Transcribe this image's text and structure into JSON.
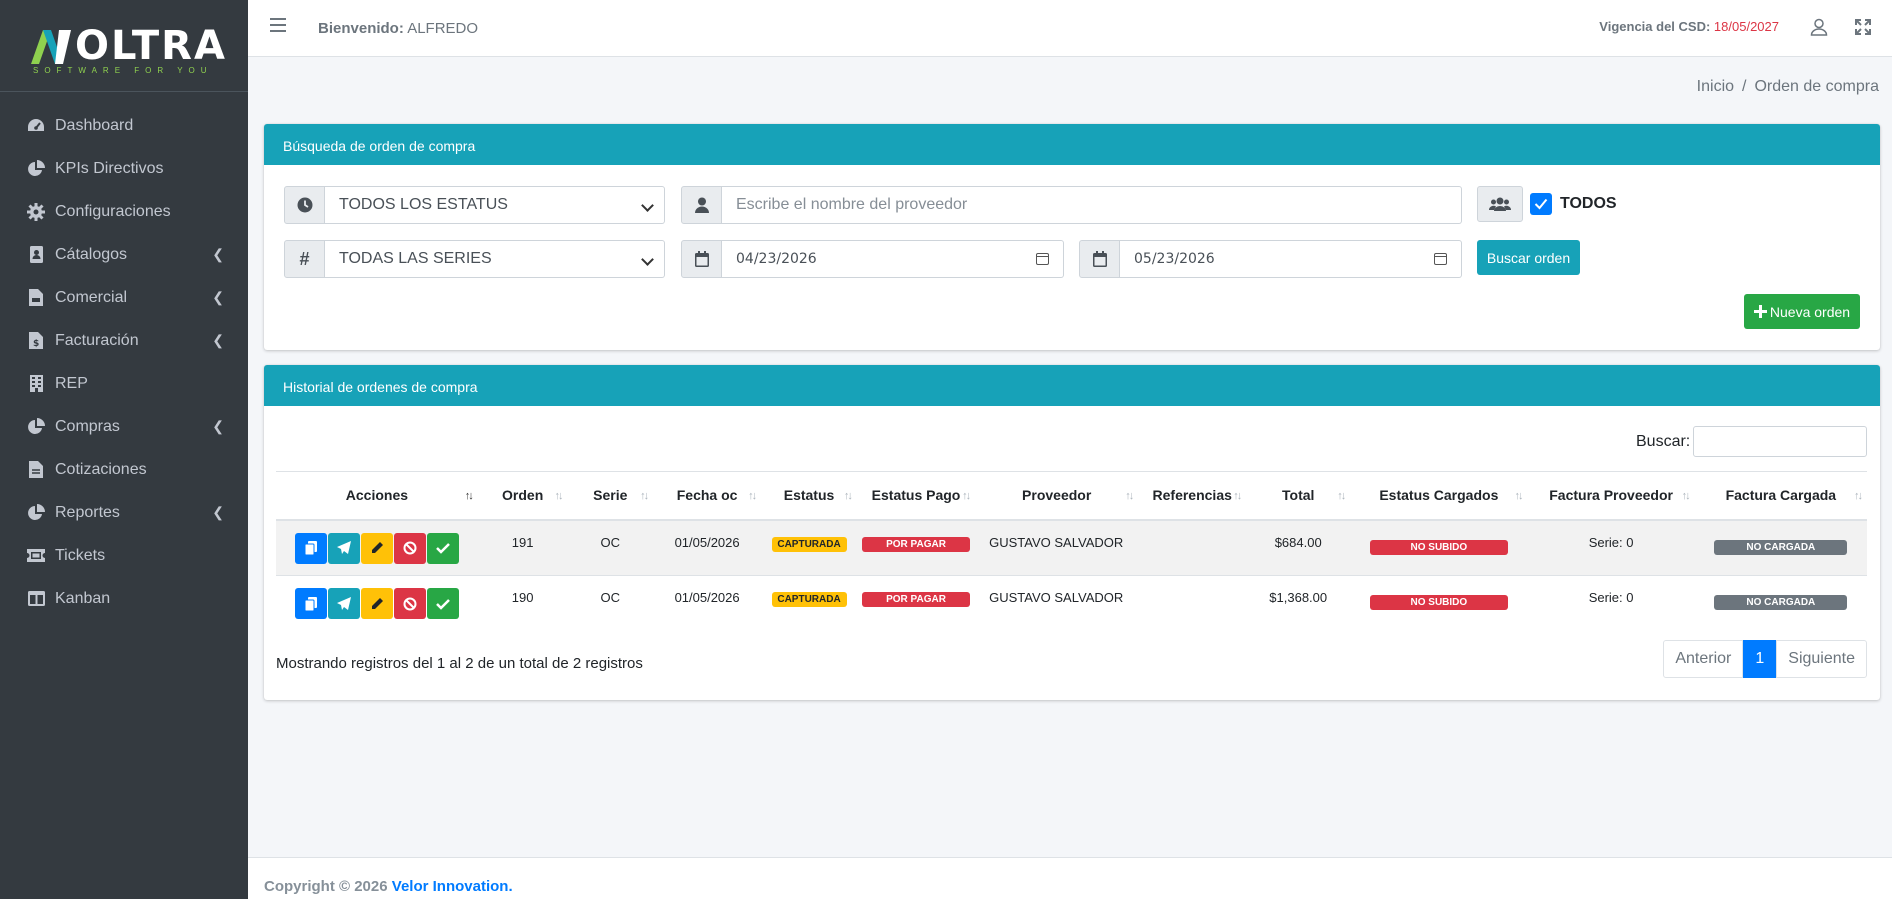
{
  "brand": {
    "name": "OLTRA",
    "tagline": "SOFTWARE FOR YOU"
  },
  "sidebar": {
    "items": [
      {
        "label": "Dashboard",
        "icon": "tachometer-icon",
        "has_submenu": false
      },
      {
        "label": "KPIs Directivos",
        "icon": "pie-chart-icon",
        "has_submenu": false
      },
      {
        "label": "Configuraciones",
        "icon": "gear-icon",
        "has_submenu": false
      },
      {
        "label": "Cátalogos",
        "icon": "address-book-icon",
        "has_submenu": true
      },
      {
        "label": "Comercial",
        "icon": "file-invoice-icon",
        "has_submenu": true
      },
      {
        "label": "Facturación",
        "icon": "file-invoice-dollar-icon",
        "has_submenu": true
      },
      {
        "label": "REP",
        "icon": "building-icon",
        "has_submenu": false
      },
      {
        "label": "Compras",
        "icon": "pie-chart-icon",
        "has_submenu": true
      },
      {
        "label": "Cotizaciones",
        "icon": "file-alt-icon",
        "has_submenu": false
      },
      {
        "label": "Reportes",
        "icon": "pie-chart-icon",
        "has_submenu": true
      },
      {
        "label": "Tickets",
        "icon": "ticket-icon",
        "has_submenu": false
      },
      {
        "label": "Kanban",
        "icon": "columns-icon",
        "has_submenu": false
      }
    ]
  },
  "topbar": {
    "welcome_label": "Bienvenido:",
    "user_name": "ALFREDO",
    "csd_label": "Vigencia del CSD:",
    "csd_date": "18/05/2027"
  },
  "breadcrumb": {
    "home": "Inicio",
    "separator": "/",
    "current": "Orden de compra"
  },
  "search_card": {
    "title": "Búsqueda de orden de compra",
    "status_select": "TODOS LOS ESTATUS",
    "series_select": "TODAS LAS SERIES",
    "provider_placeholder": "Escribe el nombre del proveedor",
    "date_from": "04/23/2026",
    "date_to": "05/23/2026",
    "todos_label": "TODOS",
    "todos_checked": true,
    "search_button": "Buscar orden",
    "new_order_button": "Nueva orden"
  },
  "history_card": {
    "title": "Historial de ordenes de compra",
    "search_label": "Buscar:",
    "columns": [
      "Acciones",
      "Orden",
      "Serie",
      "Fecha oc",
      "Estatus",
      "Estatus Pago",
      "Proveedor",
      "Referencias",
      "Total",
      "Estatus Cargados",
      "Factura Proveedor",
      "Factura Cargada"
    ],
    "rows": [
      {
        "orden": "191",
        "serie": "OC",
        "fecha": "01/05/2026",
        "estatus": "CAPTURADA",
        "estatus_pago": "POR PAGAR",
        "proveedor": "GUSTAVO SALVADOR",
        "referencias": "",
        "total": "$684.00",
        "estatus_cargados": "NO SUBIDO",
        "factura_proveedor": "Serie: 0",
        "factura_cargada": "NO CARGADA"
      },
      {
        "orden": "190",
        "serie": "OC",
        "fecha": "01/05/2026",
        "estatus": "CAPTURADA",
        "estatus_pago": "POR PAGAR",
        "proveedor": "GUSTAVO SALVADOR",
        "referencias": "",
        "total": "$1,368.00",
        "estatus_cargados": "NO SUBIDO",
        "factura_proveedor": "Serie: 0",
        "factura_cargada": "NO CARGADA"
      }
    ],
    "info": "Mostrando registros del 1 al 2 de un total de 2 registros",
    "pagination": {
      "prev": "Anterior",
      "current": "1",
      "next": "Siguiente"
    }
  },
  "footer": {
    "text": "Copyright © 2026",
    "link": "Velor Innovation."
  },
  "colors": {
    "primary": "#17a2b8",
    "success": "#28a745",
    "danger": "#dc3545",
    "warning": "#ffc107",
    "sidebar": "#343a40",
    "accent_logo": "#8fd14f"
  }
}
